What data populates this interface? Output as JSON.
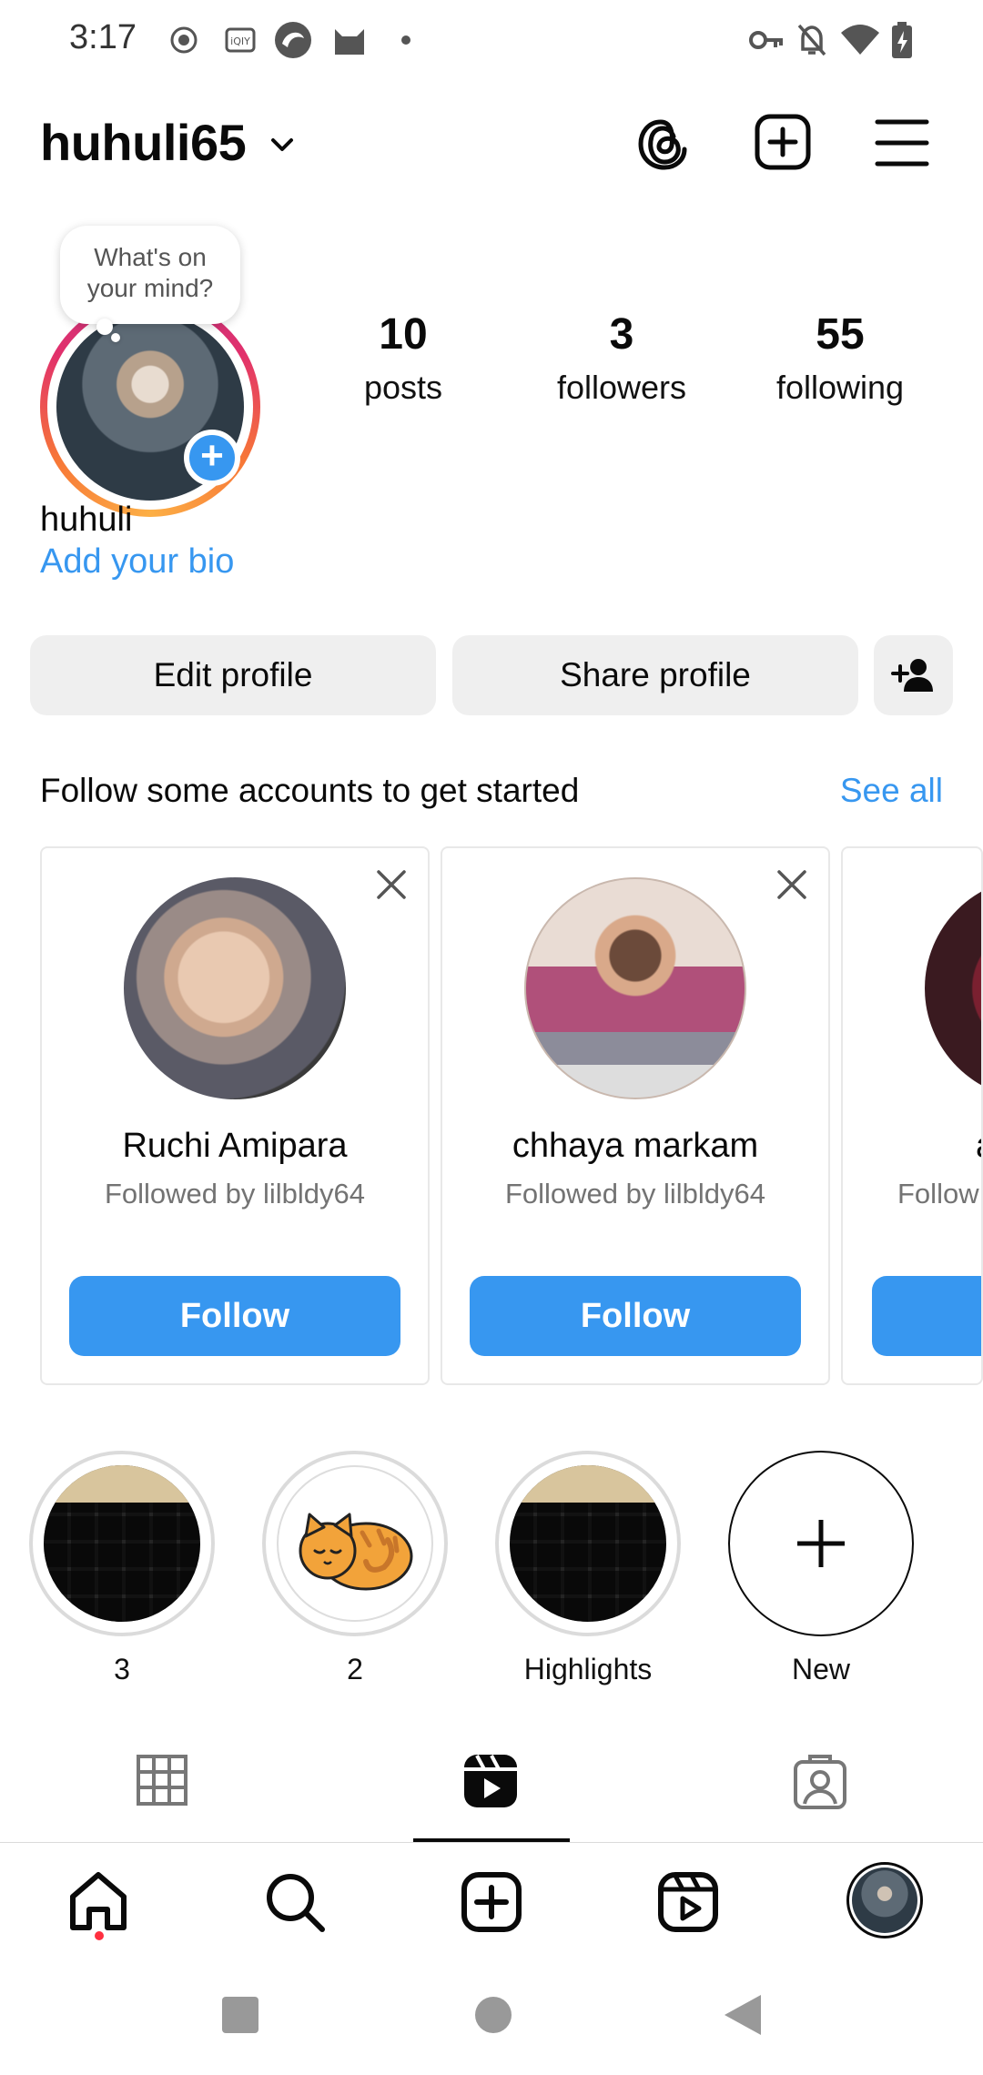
{
  "status_bar": {
    "time": "3:17"
  },
  "header": {
    "username": "huhuli65"
  },
  "profile": {
    "note_prompt": "What's on your mind?",
    "stats": [
      {
        "value": "10",
        "label": "posts"
      },
      {
        "value": "3",
        "label": "followers"
      },
      {
        "value": "55",
        "label": "following"
      }
    ],
    "display_name": "huhuli",
    "bio_link": "Add your bio",
    "edit_button": "Edit profile",
    "share_button": "Share profile"
  },
  "suggestions": {
    "title": "Follow some accounts to get started",
    "see_all": "See all",
    "cards": [
      {
        "name": "Ruchi Amipara",
        "subtitle": "Followed by lilbldy64",
        "button": "Follow"
      },
      {
        "name": "chhaya markam",
        "subtitle": "Followed by lilbldy64",
        "button": "Follow"
      },
      {
        "name": "a",
        "subtitle": "Follow"
      }
    ]
  },
  "highlights": [
    {
      "label": "3"
    },
    {
      "label": "2"
    },
    {
      "label": "Highlights"
    },
    {
      "label": "New"
    }
  ],
  "colors": {
    "accent": "#3797f0",
    "button_bg": "#efefef",
    "muted": "#737373"
  }
}
